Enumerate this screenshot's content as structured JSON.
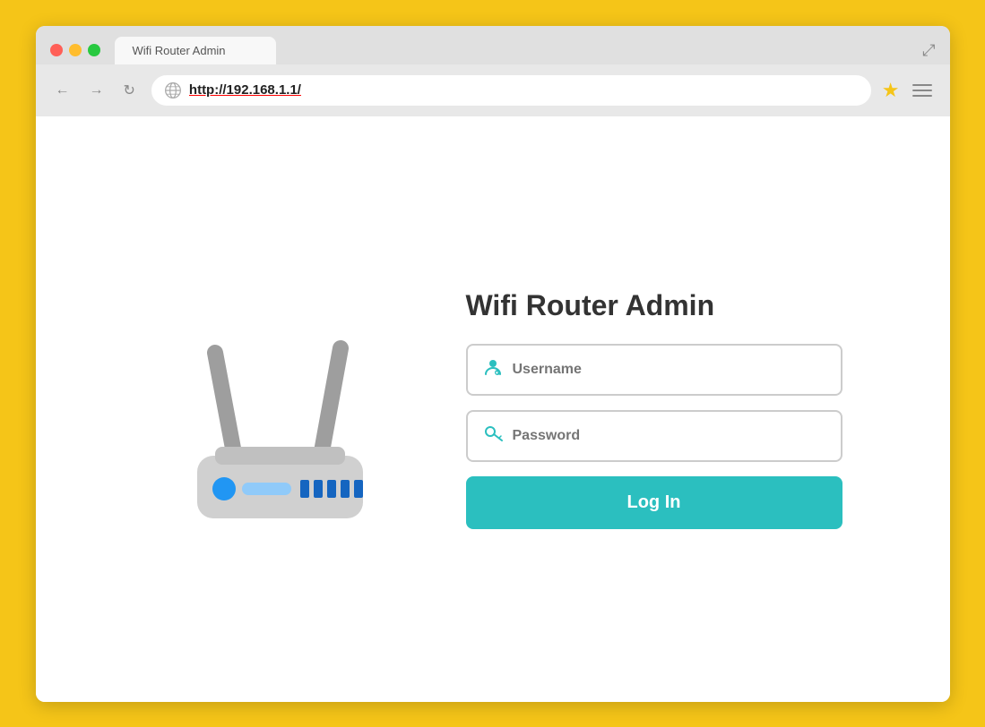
{
  "browser": {
    "url": "http://192.168.1.1/",
    "tab_label": "Wifi Router Admin",
    "fullscreen_icon": "⤢"
  },
  "nav": {
    "back_label": "←",
    "forward_label": "→",
    "reload_label": "↻"
  },
  "page": {
    "title": "Wifi Router Admin",
    "username_placeholder": "Username",
    "password_placeholder": "Password",
    "login_button": "Log In"
  }
}
